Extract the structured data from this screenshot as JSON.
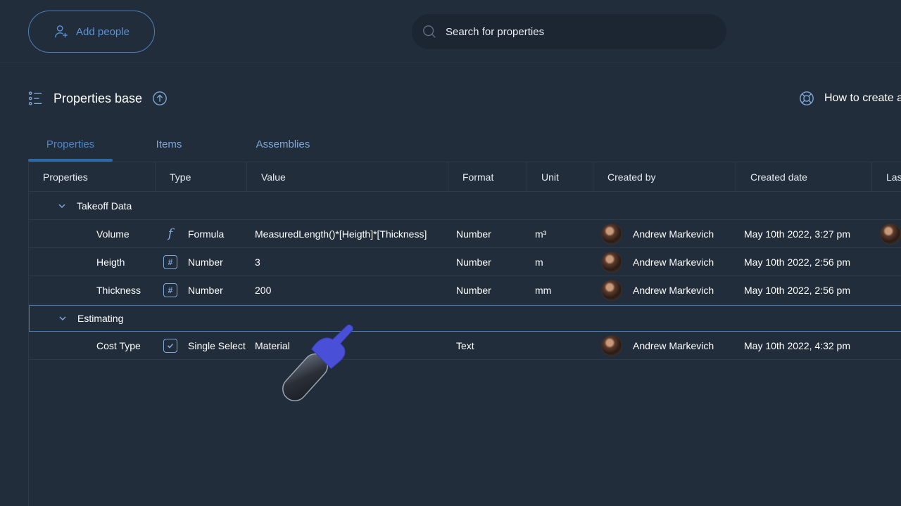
{
  "topbar": {
    "add_people_label": "Add people",
    "search_placeholder": "Search for properties"
  },
  "page": {
    "title": "Properties base",
    "help_link": "How to create a"
  },
  "tabs": [
    {
      "label": "Properties",
      "active": true
    },
    {
      "label": "Items",
      "active": false
    },
    {
      "label": "Assemblies",
      "active": false
    }
  ],
  "table": {
    "columns": [
      "Properties",
      "Type",
      "Value",
      "Format",
      "Unit",
      "Created by",
      "Created date",
      "Las"
    ],
    "groups": [
      {
        "name": "Takeoff Data",
        "rows": [
          {
            "property": "Volume",
            "type": "Formula",
            "type_icon": "formula-icon",
            "value": "MeasuredLength()*[Heigth]*[Thickness]",
            "format": "Number",
            "unit": "m³",
            "created_by": "Andrew Markevich",
            "created_date": "May 10th 2022, 3:27 pm"
          },
          {
            "property": "Heigth",
            "type": "Number",
            "type_icon": "hash-icon",
            "value": "3",
            "format": "Number",
            "unit": "m",
            "created_by": "Andrew Markevich",
            "created_date": "May 10th 2022, 2:56 pm"
          },
          {
            "property": "Thickness",
            "type": "Number",
            "type_icon": "hash-icon",
            "value": "200",
            "format": "Number",
            "unit": "mm",
            "created_by": "Andrew Markevich",
            "created_date": "May 10th 2022, 2:56 pm"
          }
        ]
      },
      {
        "name": "Estimating",
        "rows": [
          {
            "property": "Cost Type",
            "type": "Single Select",
            "type_icon": "checkbox-icon",
            "value": "Material",
            "format": "Text",
            "unit": "",
            "created_by": "Andrew Markevich",
            "created_date": "May 10th 2022, 4:32 pm"
          }
        ]
      }
    ]
  },
  "colors": {
    "background": "#222d3b",
    "accent": "#4f86c8",
    "border": "#2e3a4a",
    "selected_border": "#3f7fc1"
  }
}
